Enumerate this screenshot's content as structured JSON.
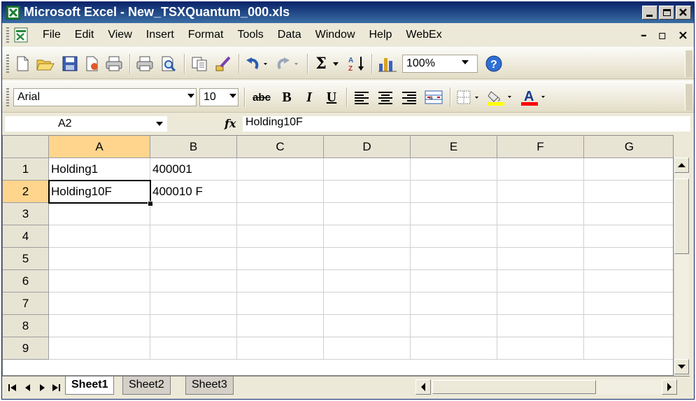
{
  "window": {
    "title": "Microsoft Excel - New_TSXQuantum_000.xls"
  },
  "menubar": {
    "items": [
      {
        "label": "File"
      },
      {
        "label": "Edit"
      },
      {
        "label": "View"
      },
      {
        "label": "Insert"
      },
      {
        "label": "Format"
      },
      {
        "label": "Tools"
      },
      {
        "label": "Data"
      },
      {
        "label": "Window"
      },
      {
        "label": "Help"
      },
      {
        "label": "WebEx"
      }
    ]
  },
  "standard_toolbar": {
    "zoom": "100%",
    "icons": [
      "new-icon",
      "open-icon",
      "save-icon",
      "permission-icon",
      "print-icon",
      "print-preview-icon",
      "copy-icon",
      "format-painter-icon",
      "undo-icon",
      "redo-icon",
      "autosum-icon",
      "sort-ascending-icon",
      "chart-wizard-icon",
      "help-icon"
    ]
  },
  "formatting_toolbar": {
    "font": "Arial",
    "font_size": "10",
    "bold": "B",
    "italic": "I",
    "underline": "U",
    "fill_color": "#ffff00",
    "font_color": "#ff0000"
  },
  "formula_bar": {
    "name_box": "A2",
    "fx": "fx",
    "formula": "Holding10F"
  },
  "sheet": {
    "columns": [
      "A",
      "B",
      "C",
      "D",
      "E",
      "F",
      "G"
    ],
    "rows": [
      "1",
      "2",
      "3",
      "4",
      "5",
      "6",
      "7",
      "8",
      "9"
    ],
    "cells": [
      [
        "Holding1",
        "400001"
      ],
      [
        "Holding10F",
        "400010 F"
      ]
    ],
    "active_cell": "A2"
  },
  "tabs": {
    "sheets": [
      "Sheet1",
      "Sheet2",
      "Sheet3"
    ],
    "active": "Sheet1"
  }
}
